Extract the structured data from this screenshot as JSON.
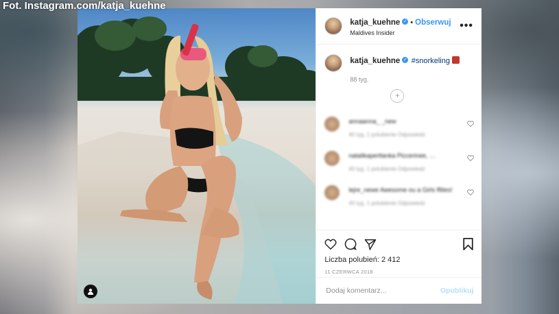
{
  "credit": "Fot. Instagram.com/katja_kuehne",
  "post": {
    "username": "katja_kuehne",
    "verified": true,
    "follow_label": "Obserwuj",
    "location": "Maldives Insider",
    "more_icon": "more-options-icon",
    "caption_username": "katja_kuehne",
    "caption_tag": "#snorkeling",
    "caption_time": "88 tyg.",
    "comments": [
      {
        "text": "annaanna_ _new",
        "sub": "40 tyg.   1 polubienie   Odpowiedz"
      },
      {
        "text": "natalikapertlanka  Piccerinee, …",
        "sub": "40 tyg.   1 polubienie   Odpowiedz"
      },
      {
        "text": "lejre_newe  Awesome ou a Girls ffilies!",
        "sub": "40 tyg.   1 polubienie   Odpowiedz"
      }
    ],
    "likes_label": "Liczba polubień: 2 412",
    "date": "11 CZERWCA 2018",
    "comment_placeholder": "Dodaj komentarz...",
    "publish_label": "Opublikuj"
  },
  "colors": {
    "accent": "#3897f0",
    "publish_disabled": "#b2dffc",
    "text": "#262626",
    "muted": "#8e8e8e"
  }
}
